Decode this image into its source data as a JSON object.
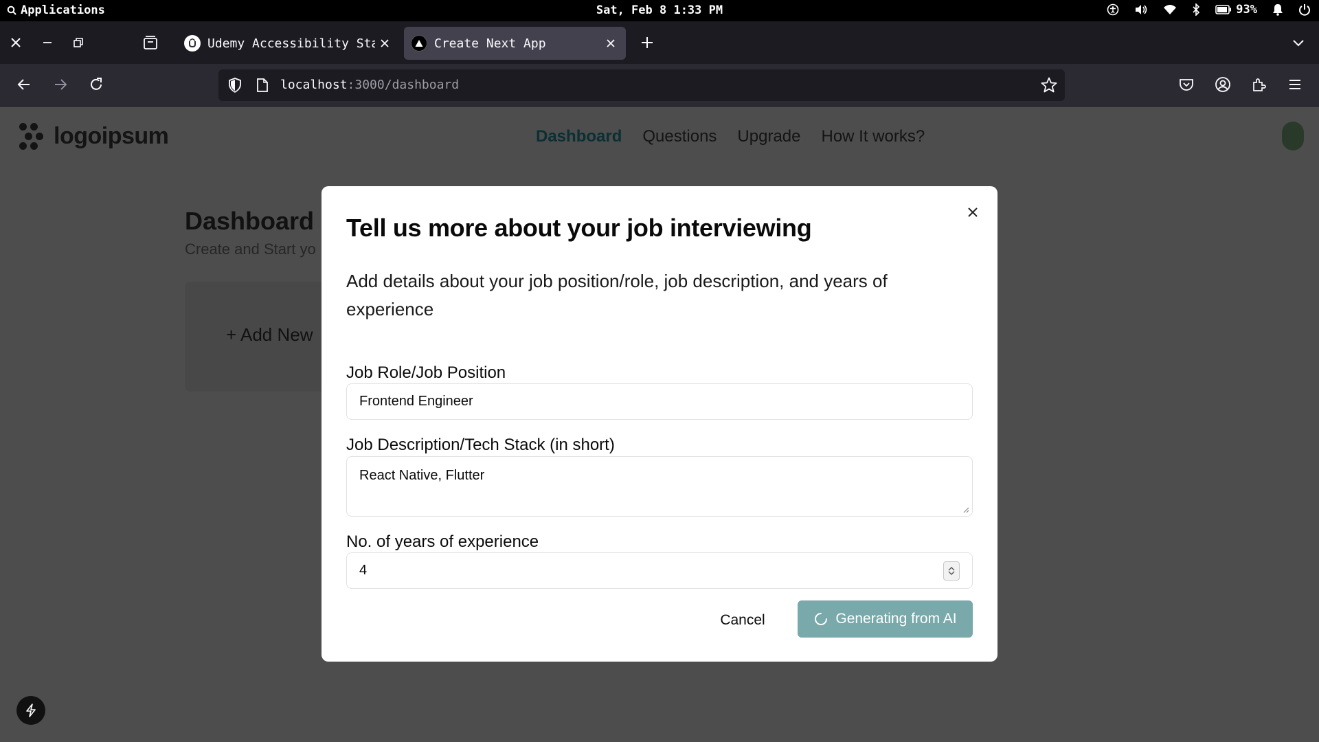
{
  "os": {
    "apps_label": "Applications",
    "clock": "Sat, Feb  8  1:33 PM",
    "battery": "93%",
    "icons": [
      "accessibility-icon",
      "volume-icon",
      "wifi-icon",
      "bluetooth-icon",
      "battery-icon",
      "bell-icon",
      "power-icon"
    ]
  },
  "browser": {
    "tabs": [
      {
        "title": "Udemy Accessibility Sta",
        "favicon": "udemy-icon",
        "active": false
      },
      {
        "title": "Create Next App",
        "favicon": "nextjs-icon",
        "active": true
      }
    ],
    "url_host": "localhost",
    "url_path": ":3000/dashboard"
  },
  "site": {
    "logo_text": "logoipsum",
    "nav": [
      "Dashboard",
      "Questions",
      "Upgrade",
      "How It works?"
    ],
    "active_nav": "Dashboard"
  },
  "dashboard": {
    "title": "Dashboard",
    "subtitle": "Create and Start yo",
    "add_new": "+ Add New"
  },
  "modal": {
    "title": "Tell us more about your job interviewing",
    "description": "Add details about your job position/role, job description, and years of experience",
    "role_label": "Job Role/Job Position",
    "role_value": "Frontend Engineer",
    "desc_label": "Job Description/Tech Stack (in short)",
    "desc_value": "React Native, Flutter",
    "years_label": "No. of years of experience",
    "years_value": "4",
    "cancel_label": "Cancel",
    "submit_label": "Generating from AI"
  },
  "colors": {
    "overlay": "#4d4d4d",
    "accent": "#79a9ab",
    "active_nav": "#0c2f33"
  }
}
